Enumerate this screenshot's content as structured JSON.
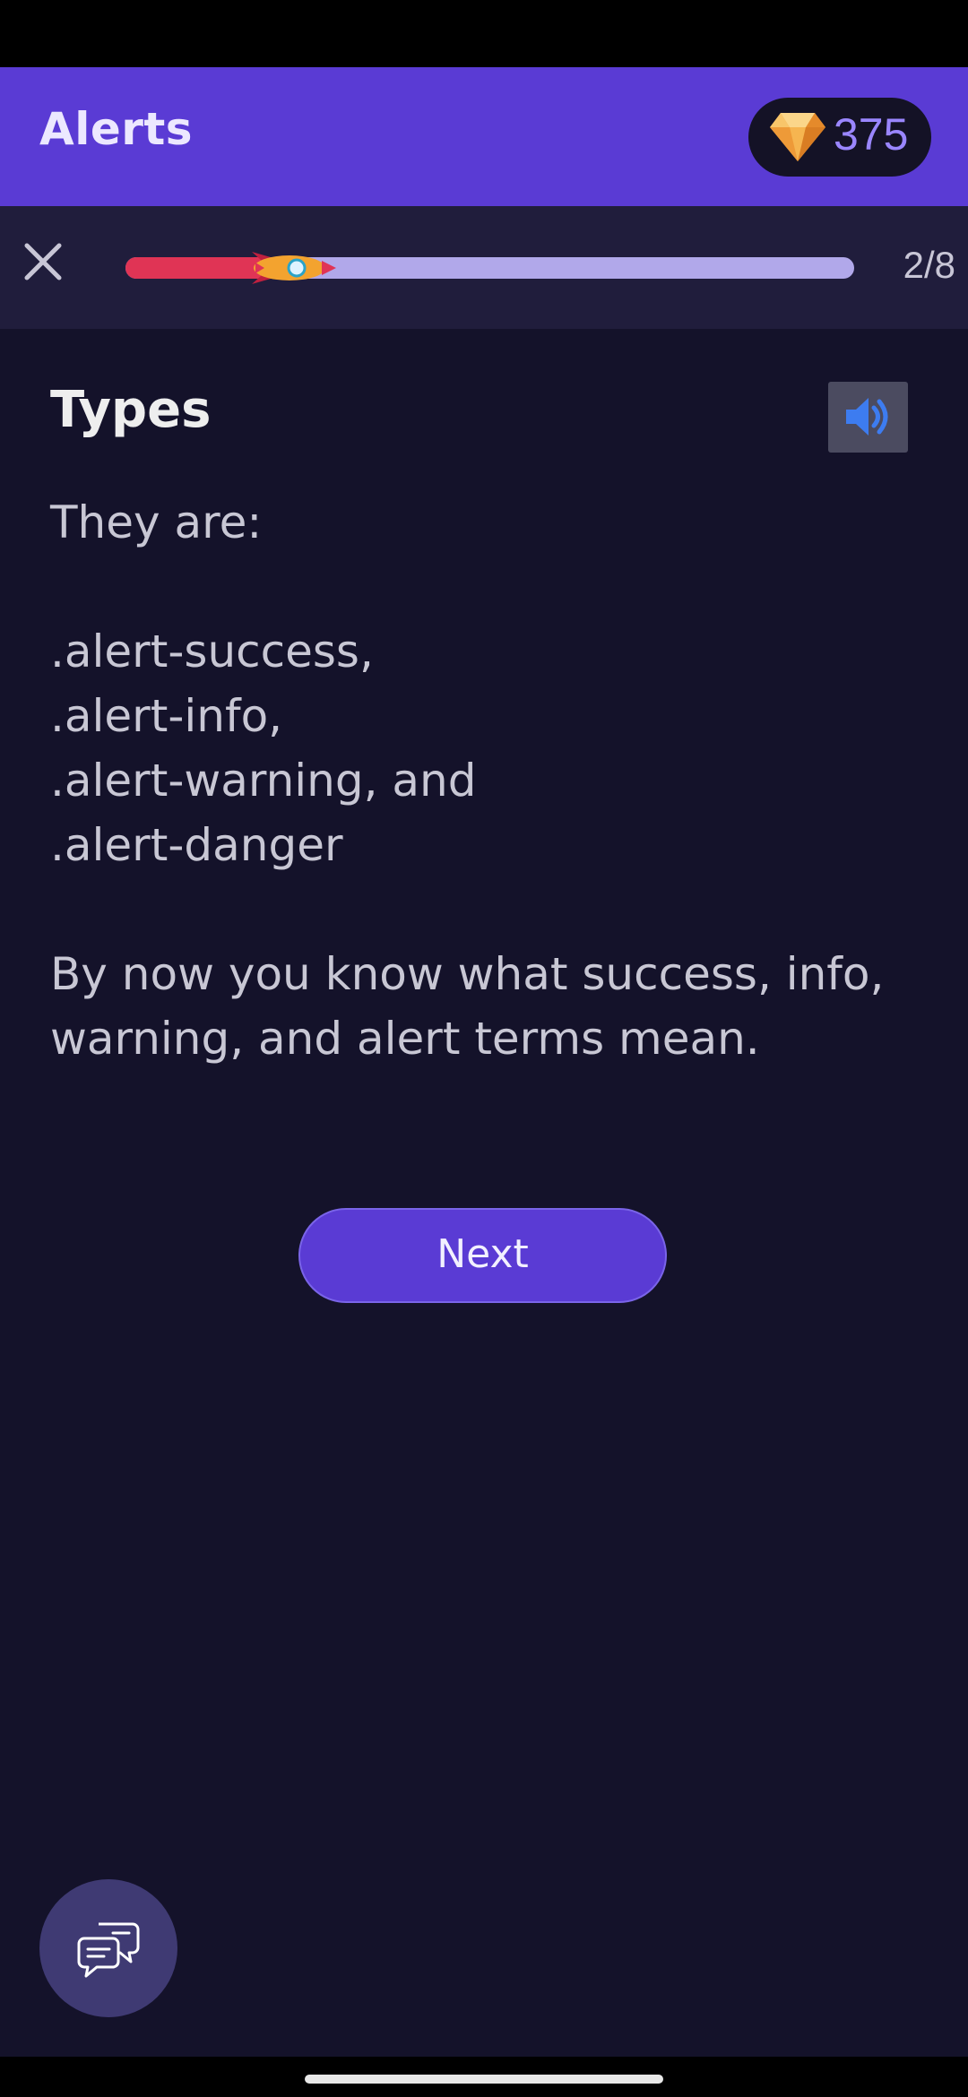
{
  "header": {
    "title": "Alerts",
    "gems": "375",
    "gem_icon": "diamond-gem-icon",
    "background": "#5a3bd4"
  },
  "progress": {
    "label": "2/8",
    "current": 2,
    "total": 8,
    "fill_fraction": 0.26,
    "fill_color": "#e03455",
    "track_color": "#b1a8ea",
    "close_icon": "close-icon",
    "marker_icon": "rocket-icon"
  },
  "lesson": {
    "title": "Types",
    "sound_icon": "speaker-icon",
    "intro": "They are:",
    "items": [
      ".alert-success,",
      ".alert-info,",
      ".alert-warning, and",
      ".alert-danger"
    ],
    "summary": "By now you know what success, info, warning, and alert terms mean."
  },
  "actions": {
    "next_label": "Next"
  },
  "chat": {
    "icon": "chat-bubbles-icon"
  }
}
